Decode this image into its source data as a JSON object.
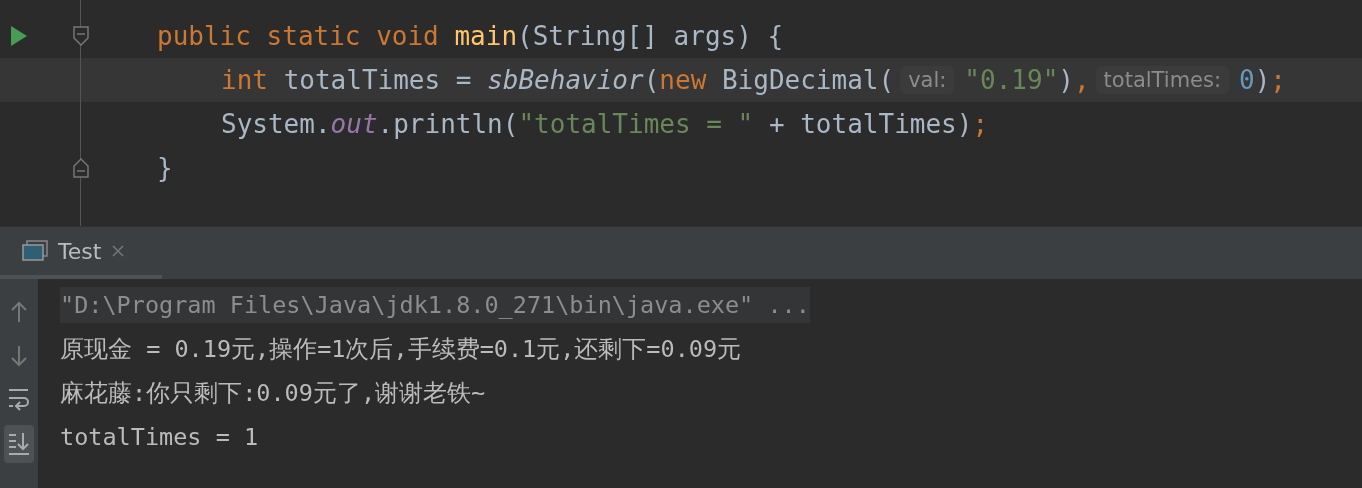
{
  "editor": {
    "lines": [
      {
        "run_marker": true,
        "fold_start": true,
        "fold_end": false,
        "current": false,
        "kind": "member",
        "segments": [
          {
            "kind": "code",
            "tokens": [
              {
                "kind": "keyword",
                "text": "public static void "
              },
              {
                "kind": "method",
                "text": "main"
              },
              {
                "kind": "plain",
                "text": "(String[] args) {"
              }
            ]
          }
        ]
      },
      {
        "run_marker": false,
        "fold_start": false,
        "fold_end": false,
        "current": true,
        "kind": "body",
        "segments": [
          {
            "kind": "code",
            "tokens": [
              {
                "kind": "keyword",
                "text": "int "
              },
              {
                "kind": "plain",
                "text": "totalTimes = "
              },
              {
                "kind": "call",
                "text": "sbBehavior"
              },
              {
                "kind": "plain",
                "text": "("
              },
              {
                "kind": "keyword",
                "text": "new "
              },
              {
                "kind": "plain",
                "text": "BigDecimal("
              }
            ]
          },
          {
            "kind": "hint",
            "text": "val:"
          },
          {
            "kind": "code",
            "tokens": [
              {
                "kind": "string",
                "text": "\"0.19\""
              },
              {
                "kind": "plain",
                "text": ")"
              },
              {
                "kind": "keyword",
                "text": ","
              }
            ]
          },
          {
            "kind": "hint",
            "text": "totalTimes:"
          },
          {
            "kind": "code",
            "tokens": [
              {
                "kind": "number",
                "text": "0"
              },
              {
                "kind": "plain",
                "text": ")"
              },
              {
                "kind": "keyword",
                "text": ";"
              }
            ]
          }
        ]
      },
      {
        "run_marker": false,
        "fold_start": false,
        "fold_end": false,
        "current": false,
        "kind": "body",
        "segments": [
          {
            "kind": "code",
            "tokens": [
              {
                "kind": "plain",
                "text": "System."
              },
              {
                "kind": "static",
                "text": "out"
              },
              {
                "kind": "plain",
                "text": ".println("
              },
              {
                "kind": "string",
                "text": "\"totalTimes = \""
              },
              {
                "kind": "plain",
                "text": " + totalTimes)"
              },
              {
                "kind": "keyword",
                "text": ";"
              }
            ]
          }
        ]
      },
      {
        "run_marker": false,
        "fold_start": false,
        "fold_end": true,
        "current": false,
        "kind": "member",
        "segments": [
          {
            "kind": "code",
            "tokens": [
              {
                "kind": "plain",
                "text": "}"
              }
            ]
          }
        ]
      }
    ]
  },
  "run_panel": {
    "tabs": [
      {
        "label": "Test",
        "selected": true
      }
    ],
    "toolbar": [
      {
        "kind": "up",
        "selected": false
      },
      {
        "kind": "down",
        "selected": false
      },
      {
        "kind": "wrap",
        "selected": false
      },
      {
        "kind": "scroll-end",
        "selected": true
      }
    ],
    "console": [
      {
        "text": "\"D:\\Program Files\\Java\\jdk1.8.0_271\\bin\\java.exe\" ...",
        "kind": "command"
      },
      {
        "text": "原现金 = 0.19元,操作=1次后,手续费=0.1元,还剩下=0.09元",
        "kind": "output"
      },
      {
        "text": "麻花藤:你只剩下:0.09元了,谢谢老铁~",
        "kind": "output"
      },
      {
        "text": "totalTimes = 1",
        "kind": "output"
      }
    ]
  }
}
